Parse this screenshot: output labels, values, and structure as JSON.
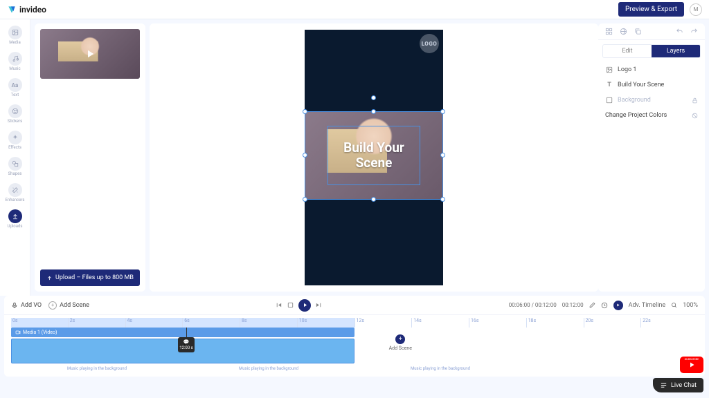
{
  "brand": "invideo",
  "header": {
    "preview_export": "Preview & Export",
    "user_initial": "M"
  },
  "rail": [
    {
      "key": "media",
      "label": "Media"
    },
    {
      "key": "music",
      "label": "Music"
    },
    {
      "key": "text",
      "label": "Text"
    },
    {
      "key": "stickers",
      "label": "Stickers"
    },
    {
      "key": "effects",
      "label": "Effects"
    },
    {
      "key": "shapes",
      "label": "Shapes"
    },
    {
      "key": "enhancers",
      "label": "Enhancers"
    },
    {
      "key": "uploads",
      "label": "Uploads",
      "active": true
    }
  ],
  "uploads": {
    "upload_button": "Upload – Files up to 800 MB"
  },
  "stage": {
    "logo_badge": "LOGO",
    "overlay_text": "Build Your Scene"
  },
  "right_panel": {
    "tabs": {
      "edit": "Edit",
      "layers": "Layers"
    },
    "layers": [
      {
        "icon": "picture",
        "label": "Logo 1"
      },
      {
        "icon": "text",
        "label": "Build Your Scene"
      },
      {
        "icon": "picture",
        "label": "Background",
        "dim": true,
        "lock": true
      },
      {
        "icon": "palette",
        "label": "Change Project Colors",
        "gear": true
      }
    ]
  },
  "toolbar": {
    "add_vo": "Add VO",
    "add_scene": "Add Scene",
    "time_current": "00:06:00",
    "time_total": "00:12:00",
    "time_scene": "00:12:00",
    "adv_timeline": "Adv. Timeline",
    "zoom": "100%"
  },
  "timeline": {
    "ruler": [
      "0s",
      "2s",
      "4s",
      "6s",
      "8s",
      "10s",
      "12s",
      "14s",
      "16s",
      "18s",
      "20s",
      "22s"
    ],
    "media_label": "Media 1 (Video)",
    "playhead_time": "12:00 s",
    "add_scene": "Add Scene",
    "music_caption": "Music playing in the background"
  },
  "live_chat": "Live Chat",
  "yt_subscribe": "SUBSCRIBE"
}
